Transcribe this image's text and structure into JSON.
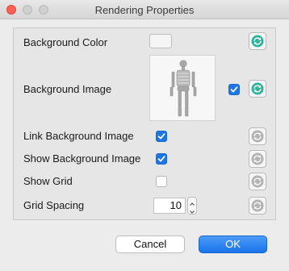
{
  "window": {
    "title": "Rendering Properties"
  },
  "properties": {
    "background_color": {
      "label": "Background Color",
      "value": "#f5f5f5"
    },
    "background_image": {
      "label": "Background Image",
      "checked": true
    },
    "link_background_image": {
      "label": "Link Background Image",
      "checked": true
    },
    "show_background_image": {
      "label": "Show Background Image",
      "checked": true
    },
    "show_grid": {
      "label": "Show Grid",
      "checked": false
    },
    "grid_spacing": {
      "label": "Grid Spacing",
      "value": "10"
    }
  },
  "icons": {
    "reset": "reset-icon",
    "checkmark": "checkmark-icon",
    "skeleton": "skeleton-image"
  },
  "buttons": {
    "cancel": "Cancel",
    "ok": "OK"
  },
  "colors": {
    "accent": "#1c76e6",
    "reset_active": "#2fb39a",
    "reset_disabled": "#b3b3b3"
  }
}
